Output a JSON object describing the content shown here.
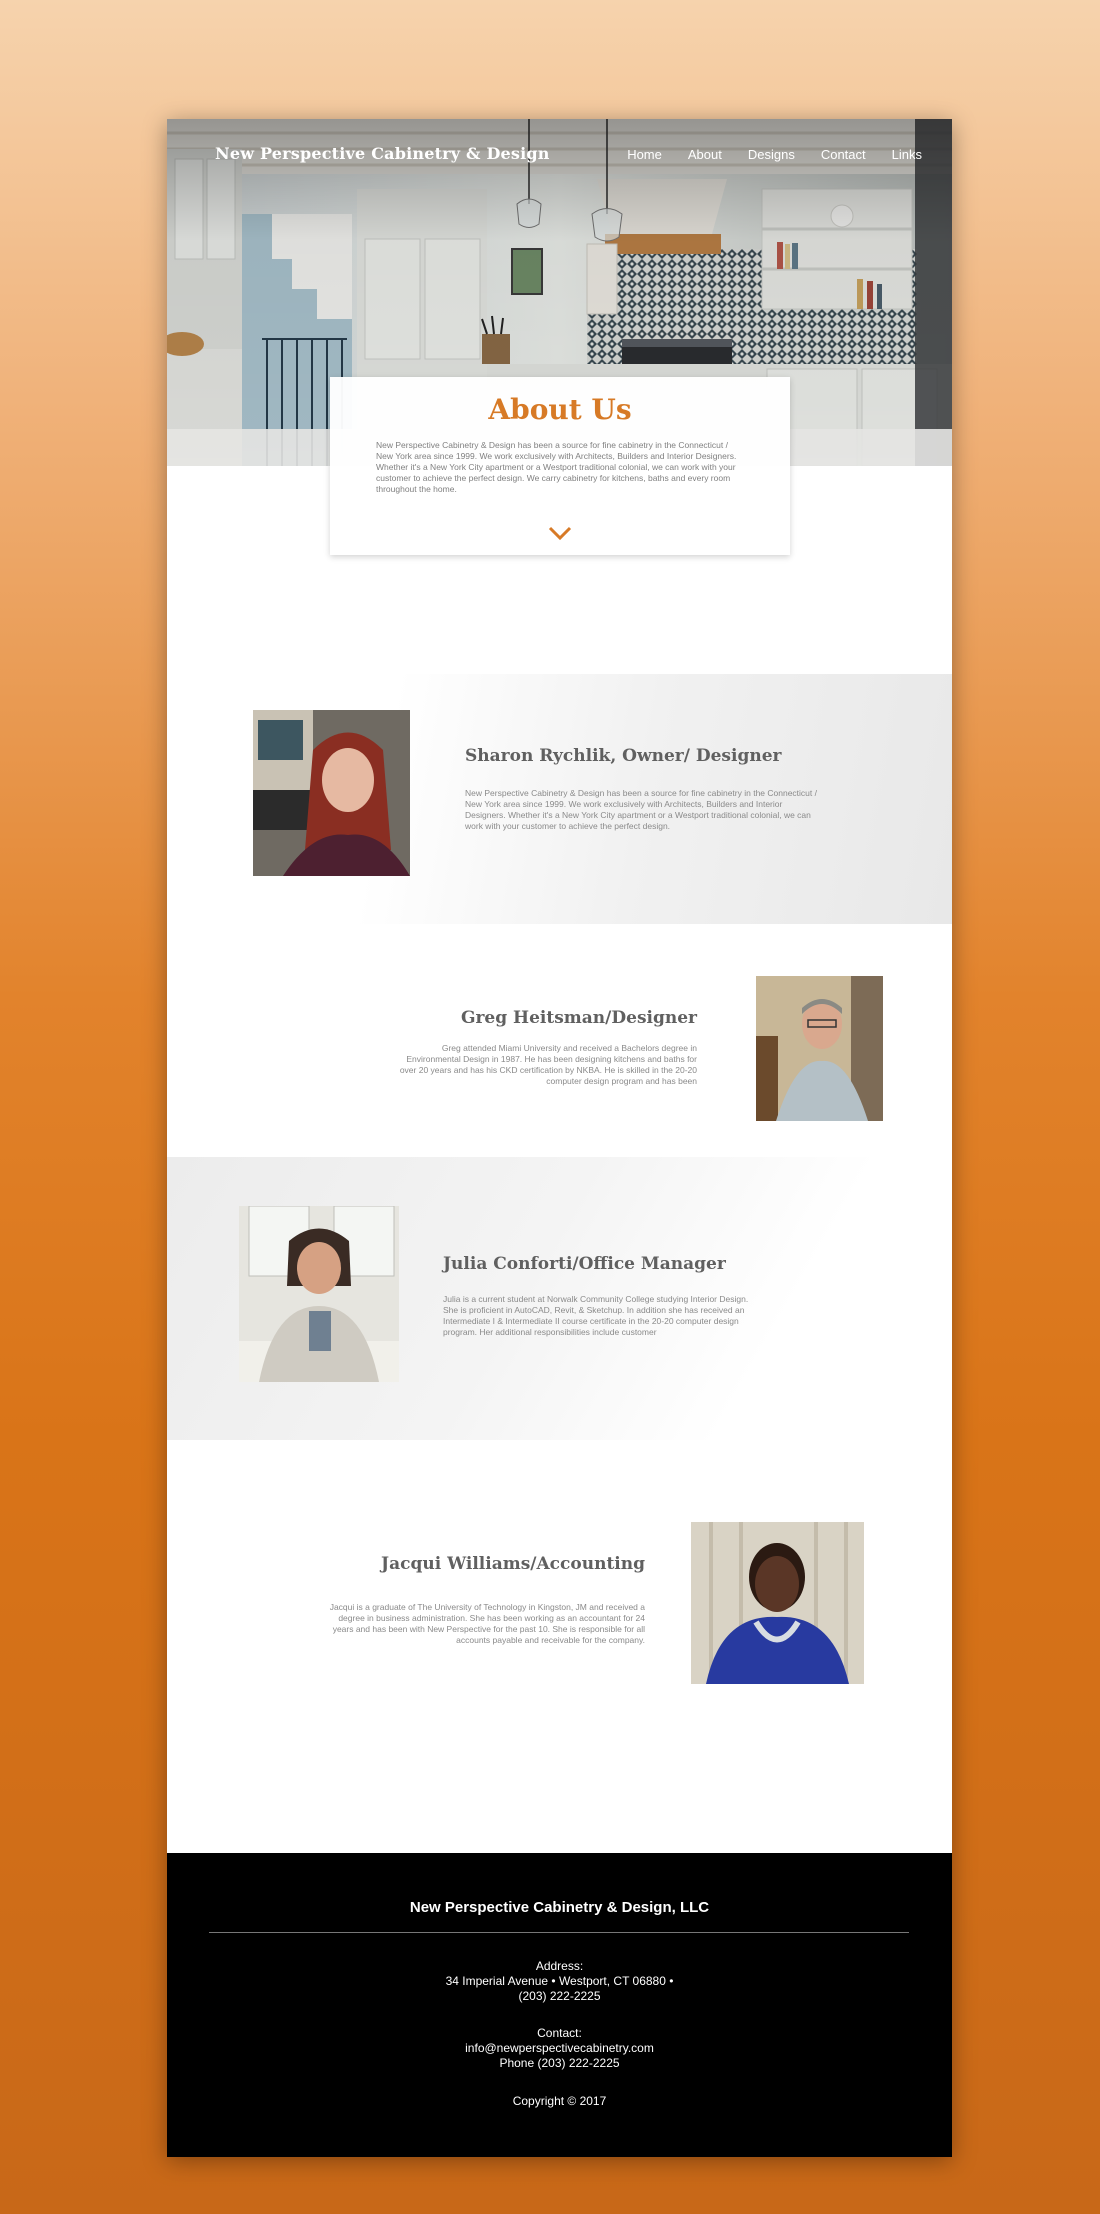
{
  "header": {
    "brand": "New Perspective Cabinetry & Design",
    "nav": [
      "Home",
      "About",
      "Designs",
      "Contact",
      "Links"
    ]
  },
  "about": {
    "title": "About Us",
    "text": "New Perspective Cabinetry & Design has been a source for fine cabinetry in the Connecticut / New York area since 1999. We work exclusively with Architects, Builders and Interior Designers. Whether it's a New York City apartment or a Westport traditional colonial, we can work with your customer to achieve the perfect design. We carry cabinetry for kitchens, baths and every room throughout the home.",
    "chevron_icon": "chevron-down-icon"
  },
  "team": [
    {
      "name": "Sharon Rychlik, Owner/ Designer",
      "bio": "New Perspective Cabinetry & Design has been a source for fine cabinetry in the Connecticut / New York area since 1999. We work exclusively with Architects, Builders and Interior Designers. Whether it's a New York City apartment or a Westport traditional colonial, we can work with your customer to achieve the perfect design."
    },
    {
      "name": "Greg Heitsman/Designer",
      "bio": "Greg attended Miami University and received a Bachelors degree in Environmental Design in 1987. He has been designing kitchens and baths for over 20 years and has his CKD certification by NKBA. He is skilled in the 20-20 computer design program and has been"
    },
    {
      "name": "Julia Conforti/Office Manager",
      "bio": "Julia is a current student at Norwalk Community College studying Interior Design. She is proficient in AutoCAD, Revit, & Sketchup. In addition she has received an Intermediate I & Intermediate II course certificate in the 20-20 computer design program. Her additional responsibilities include customer"
    },
    {
      "name": "Jacqui Williams/Accounting",
      "bio": "Jacqui is a graduate of The University of Technology in Kingston, JM and received a degree in business administration. She has been working as an accountant for  24 years and has been with New Perspective for the past 10. She is responsible for all accounts payable and receivable for the company."
    }
  ],
  "footer": {
    "company": "New Perspective Cabinetry & Design, LLC",
    "address_label": "Address:",
    "address_line": "34 Imperial Avenue • Westport, CT 06880 •",
    "address_phone": "(203) 222-2225",
    "contact_label": "Contact:",
    "email": "info@newperspectivecabinetry.com",
    "phone": "Phone (203) 222-2225",
    "copyright": "Copyright © 2017"
  },
  "colors": {
    "accent": "#d77a26",
    "footer_bg": "#000000"
  }
}
